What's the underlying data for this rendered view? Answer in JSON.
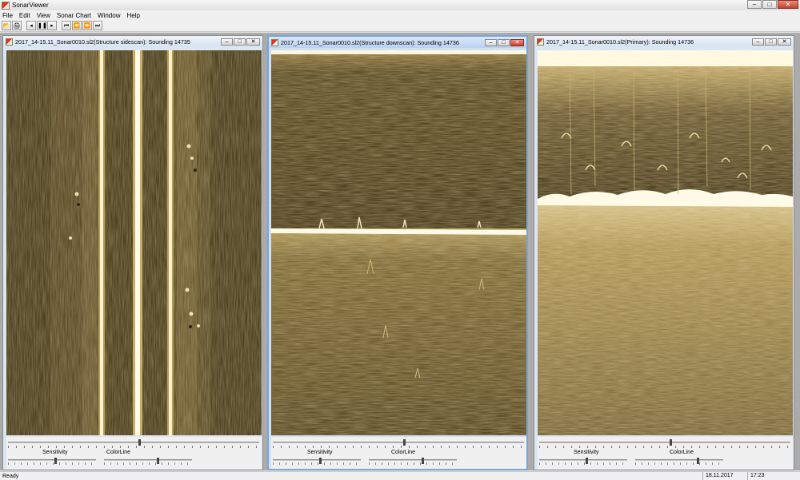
{
  "app": {
    "title": "SonarViewer"
  },
  "window_controls": {
    "minimize": "–",
    "maximize": "□",
    "close": "✕"
  },
  "menu": [
    "File",
    "Edit",
    "View",
    "Sonar Chart",
    "Window",
    "Help"
  ],
  "toolbar": {
    "buttons": [
      {
        "name": "open-icon",
        "glyph": "📂"
      },
      {
        "name": "print-icon",
        "glyph": "🖨"
      },
      {
        "name": "step-back-icon",
        "glyph": "◂"
      },
      {
        "name": "pause-icon",
        "glyph": "❚❚"
      },
      {
        "name": "play-icon",
        "glyph": "▸"
      },
      {
        "name": "skip-start-icon",
        "glyph": "⏮"
      },
      {
        "name": "rewind-icon",
        "glyph": "⏪"
      },
      {
        "name": "fast-forward-icon",
        "glyph": "⏩"
      },
      {
        "name": "skip-end-icon",
        "glyph": "⏭"
      }
    ]
  },
  "child_controls": {
    "minimize": "–",
    "maximize": "□",
    "close": "✕"
  },
  "windows": [
    {
      "title": "2017_14-15.11_Sonar0010.sl2(Structure sidescan): Sounding 14735",
      "view": "sidescan",
      "active": false,
      "sensitivity_label": "Sensitivity",
      "colorline_label": "ColorLine",
      "position": 0.52,
      "sensitivity": 0.53,
      "colorline": 0.6
    },
    {
      "title": "2017_14-15.11_Sonar0010.sl2(Structure downscan): Sounding 14736",
      "view": "downscan",
      "active": true,
      "sensitivity_label": "Sensitivity",
      "colorline_label": "ColorLine",
      "position": 0.52,
      "sensitivity": 0.53,
      "colorline": 0.6
    },
    {
      "title": "2017_14-15.11_Sonar0010.sl2(Primary): Sounding 14736",
      "view": "primary",
      "active": false,
      "sensitivity_label": "Sensitivity",
      "colorline_label": "ColorLine",
      "position": 0.52,
      "sensitivity": 0.53,
      "colorline": 0.7
    }
  ],
  "colors": {
    "sonar_dark": "#4b3f1e",
    "sonar_mid": "#8a7440",
    "sonar_bright": "#fffbe6",
    "primary_light": "#c0a868"
  },
  "status": {
    "text": "Ready",
    "date": "18.11.2017",
    "time": "17:23"
  }
}
